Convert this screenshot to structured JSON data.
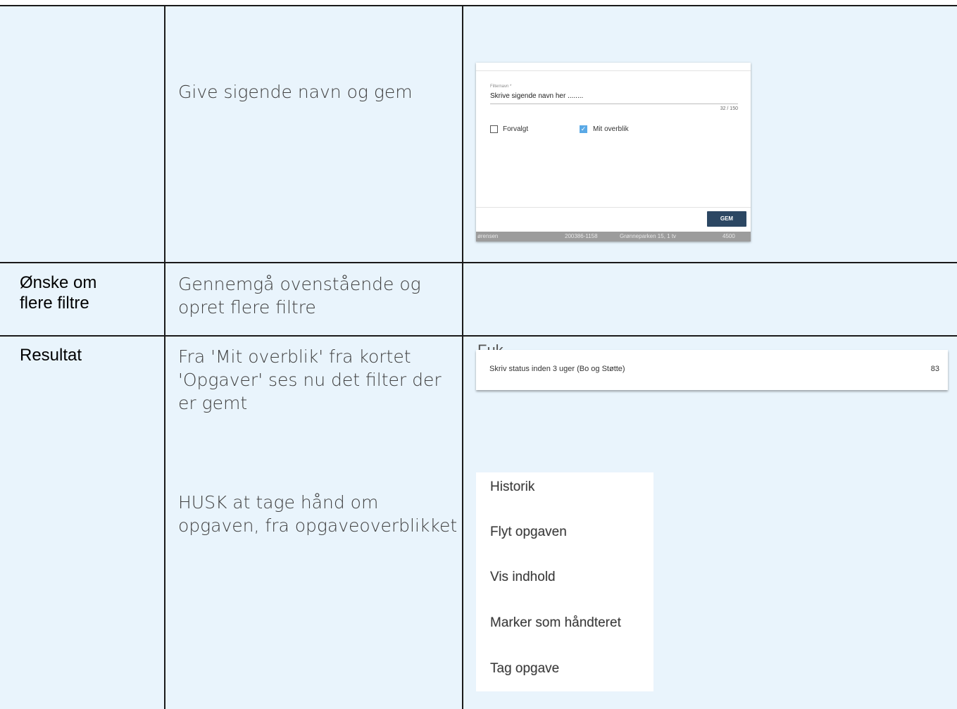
{
  "rows": [
    {
      "label": "",
      "description": [
        "Give sigende navn og gem"
      ]
    },
    {
      "label": "Ønske om\nflere filtre",
      "description": [
        "Gennemgå ovenstående og\nopret flere filtre"
      ]
    },
    {
      "label": "Resultat",
      "description": [
        "Fra 'Mit overblik' fra kortet\n'Opgaver' ses nu det filter der\ner gemt",
        "HUSK at tage hånd om\nopgaven, fra opgaveoverblikket"
      ]
    }
  ],
  "filter_dialog": {
    "field_label": "Filternavn *",
    "field_value": "Skrive sigende navn her ........",
    "counter": "32 / 150",
    "checkbox_default": {
      "label": "Forvalgt",
      "checked": false
    },
    "checkbox_overview": {
      "label": "Mit overblik",
      "checked": true
    },
    "save_label": "GEM",
    "background_row": [
      "ørensen",
      "200386-1158",
      "Grønneparken 15, 1 tv",
      "4500"
    ]
  },
  "status_card": {
    "title_partial": "Fuk",
    "filter_name": "Skriv status inden 3 uger (Bo og Støtte)",
    "count": "83"
  },
  "context_menu": {
    "items": [
      "Historik",
      "Flyt opgaven",
      "Vis indhold",
      "Marker som håndteret",
      "Tag opgave"
    ]
  },
  "colors": {
    "cell_background": "#e9f4fc",
    "border": "#1a1a1a",
    "checkbox_checked": "#5aa9e6",
    "save_button": "#2c4763"
  }
}
